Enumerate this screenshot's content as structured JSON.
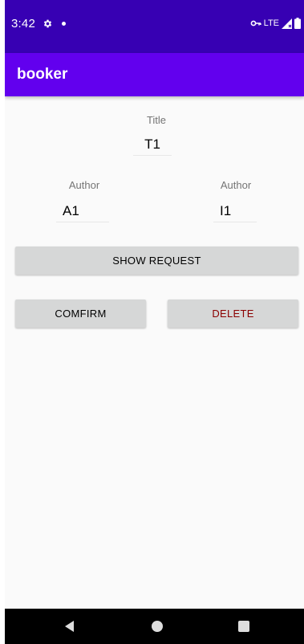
{
  "status_bar": {
    "time": "3:42",
    "network": "LTE",
    "icons": [
      "gear-icon",
      "notification-dot",
      "vpn-key-icon",
      "signal-icon",
      "battery-icon"
    ]
  },
  "app_bar": {
    "title": "booker",
    "color": "#6200ee",
    "status_color": "#3700b3"
  },
  "form": {
    "title_label": "Title",
    "title_value": "T1",
    "author_left_label": "Author",
    "author_left_value": "A1",
    "author_right_label": "Author",
    "author_right_value": "I1"
  },
  "buttons": {
    "show_request": "SHOW REQUEST",
    "confirm": "COMFIRM",
    "delete": "DELETE",
    "delete_color": "#8b0000"
  },
  "nav": {
    "icons": [
      "back-icon",
      "home-icon",
      "recents-icon"
    ]
  }
}
